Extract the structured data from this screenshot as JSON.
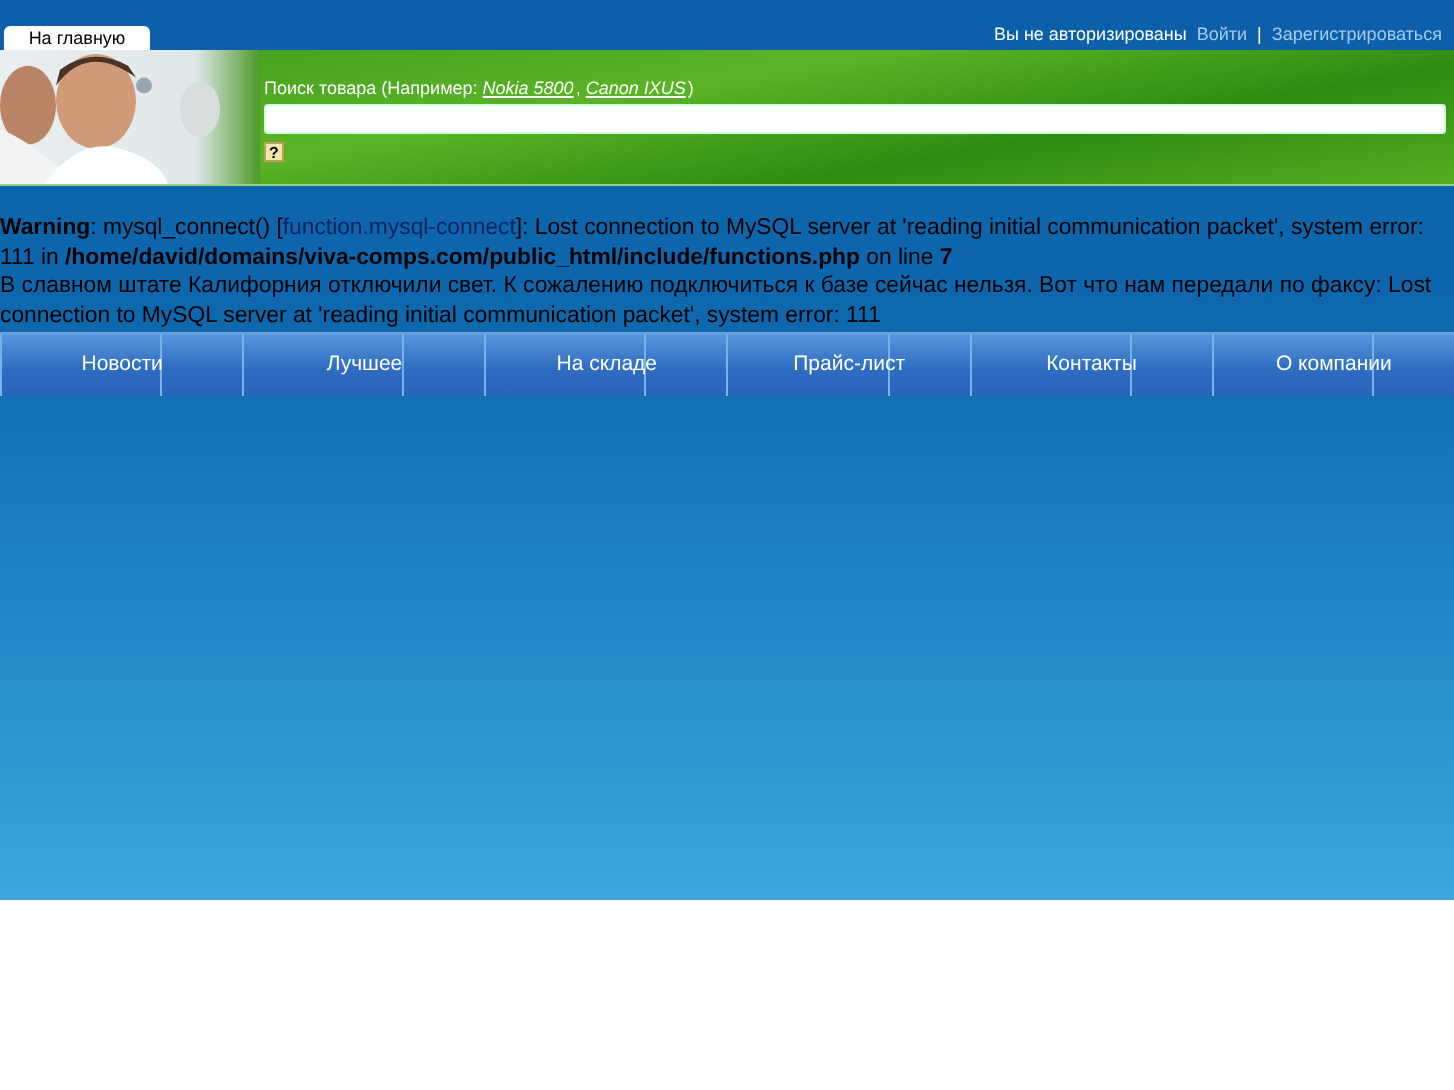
{
  "home_tab": {
    "label": "На главную",
    "selected": true
  },
  "auth": {
    "status": "Вы не авторизированы",
    "links": [
      "Войти",
      "Зарегистрироваться"
    ],
    "separator": "|"
  },
  "search": {
    "label": "Поиск товара (Например: *Nokia 5800*, *Canon IXUS*)",
    "help": "?"
  },
  "warning": {
    "before": "**Warning**: mysql_connect() [",
    "link": "function.mysql-connect",
    "after": "]: Lost connection to MySQL server at 'reading initial communication packet', system error: 111 in **/home/david/domains/viva-comps.com/public_html/include/functions.php** on line **7**"
  },
  "message": "В славном штате Калифорния отключили свет. К сожалению подключиться к базе сейчас нельзя. Вот что нам передали по факсу: Lost connection to MySQL server at 'reading initial communication packet', system error: 111",
  "nav": [
    "Новости",
    "Лучшее",
    "На складе",
    "Прайс-лист",
    "Контакты",
    "О компании"
  ]
}
